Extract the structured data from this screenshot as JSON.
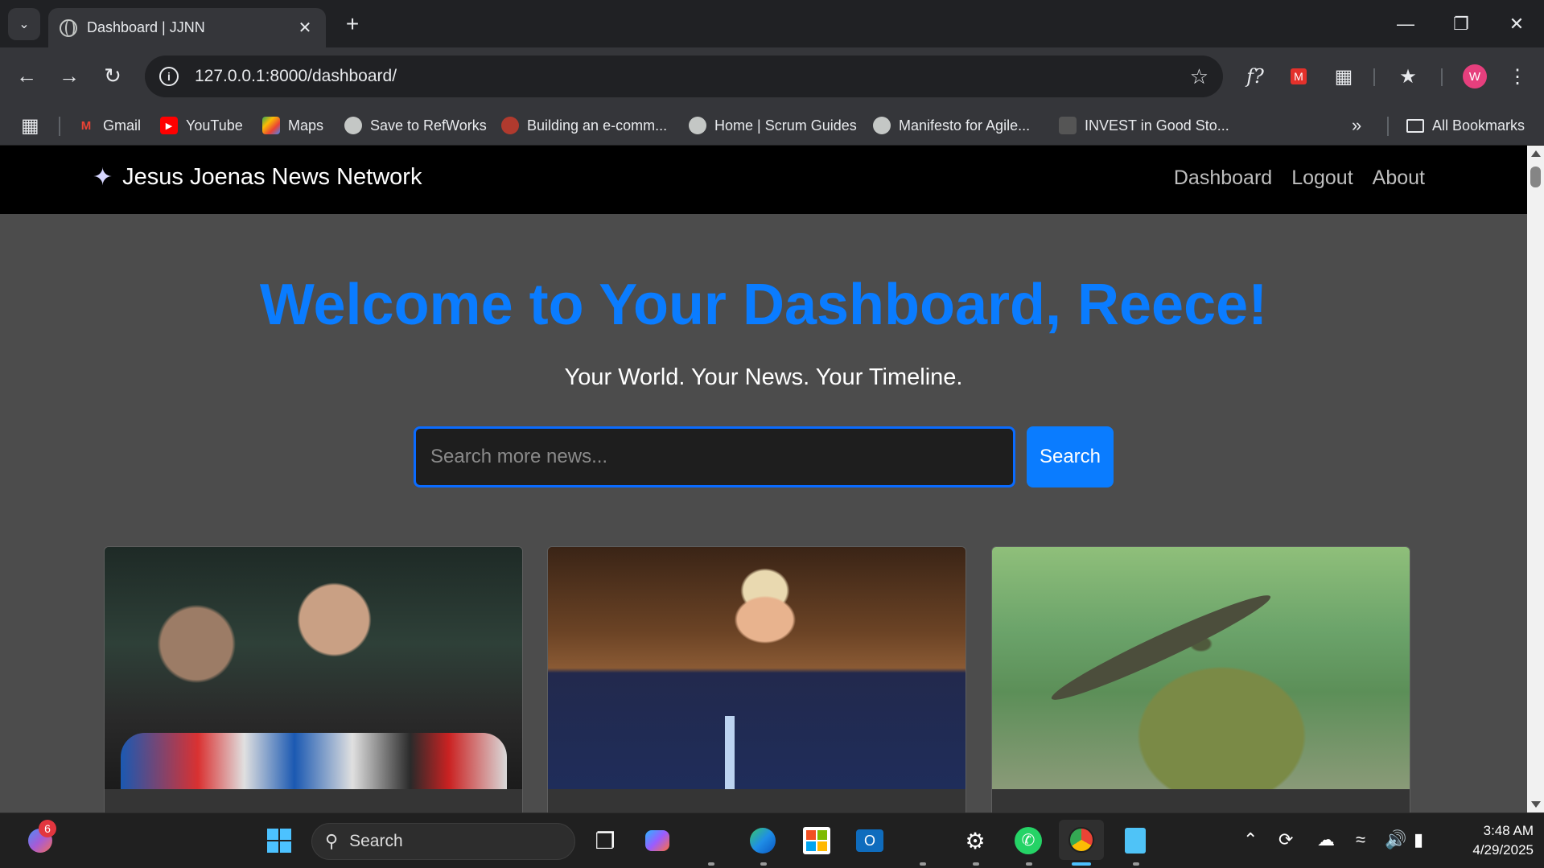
{
  "browser": {
    "tab_title": "Dashboard | JJNN",
    "url": "127.0.0.1:8000/dashboard/",
    "profile_initial": "W"
  },
  "bookmarks": [
    {
      "label": "Gmail",
      "icon": "gmail-icon"
    },
    {
      "label": "YouTube",
      "icon": "youtube-icon"
    },
    {
      "label": "Maps",
      "icon": "maps-icon"
    },
    {
      "label": "Save to RefWorks",
      "icon": "globe-icon"
    },
    {
      "label": "Building an e-comm...",
      "icon": "site-icon"
    },
    {
      "label": "Home | Scrum Guides",
      "icon": "globe-icon"
    },
    {
      "label": "Manifesto for Agile...",
      "icon": "globe-icon"
    },
    {
      "label": "INVEST in Good Sto...",
      "icon": "site-icon"
    }
  ],
  "all_bookmarks_label": "All Bookmarks",
  "site": {
    "brand": "Jesus Joenas News Network",
    "nav": [
      "Dashboard",
      "Logout",
      "About"
    ],
    "hero_title": "Welcome to Your Dashboard, Reece!",
    "hero_subtitle": "Your World. Your News. Your Timeline.",
    "search_placeholder": "Search more news...",
    "search_button": "Search",
    "accent_color": "#0a7cff"
  },
  "cards": [
    {
      "image": "press-conference-photo"
    },
    {
      "image": "speaker-at-podium-photo"
    },
    {
      "image": "newt-on-rock-photo"
    }
  ],
  "taskbar": {
    "search_label": "Search",
    "notification_count": "6",
    "time": "3:48 AM",
    "date": "4/29/2025"
  }
}
